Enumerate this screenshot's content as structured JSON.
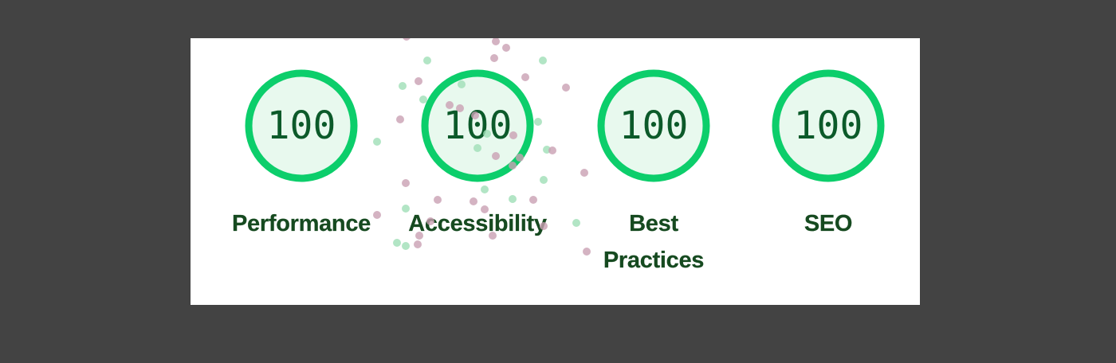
{
  "colors": {
    "page_background": "#434343",
    "card_background": "#ffffff",
    "pass_ring": "#0cce6b",
    "pass_fill": "#e8f9ee",
    "score_text": "#0c5a2a",
    "label_text": "#164a20",
    "confetti_pink": "#c9a0b3",
    "confetti_green": "#9fdfb6"
  },
  "gauges": [
    {
      "category": "Performance",
      "score": "100"
    },
    {
      "category": "Accessibility",
      "score": "100"
    },
    {
      "category": "Best Practices",
      "score": "100"
    },
    {
      "category": "SEO",
      "score": "100"
    }
  ]
}
